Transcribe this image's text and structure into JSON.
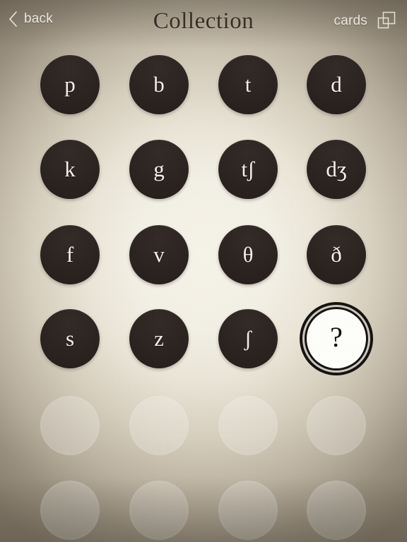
{
  "header": {
    "back_label": "back",
    "back_icon": "chevron-left-icon",
    "title": "Collection",
    "cards_label": "cards",
    "cards_icon": "overlapping-squares-icon"
  },
  "colors": {
    "background_center": "#f2efe4",
    "background_edge": "#857b6b",
    "tile_fill": "#2c2421",
    "tile_glyph": "#f4f0e8",
    "title_text": "#382e24",
    "header_text": "#ece8e1",
    "unknown_tile_fill": "#fdfdfa",
    "unknown_tile_ring": "#151210",
    "placeholder_tile": "rgba(255,255,255,0.22)"
  },
  "grid": {
    "columns": 4,
    "tiles": [
      {
        "label": "p",
        "state": "filled"
      },
      {
        "label": "b",
        "state": "filled"
      },
      {
        "label": "t",
        "state": "filled"
      },
      {
        "label": "d",
        "state": "filled"
      },
      {
        "label": "k",
        "state": "filled"
      },
      {
        "label": "g",
        "state": "filled"
      },
      {
        "label": "tʃ",
        "state": "filled"
      },
      {
        "label": "dʒ",
        "state": "filled"
      },
      {
        "label": "f",
        "state": "filled"
      },
      {
        "label": "v",
        "state": "filled"
      },
      {
        "label": "θ",
        "state": "filled"
      },
      {
        "label": "ð",
        "state": "filled"
      },
      {
        "label": "s",
        "state": "filled"
      },
      {
        "label": "z",
        "state": "filled"
      },
      {
        "label": "ʃ",
        "state": "filled"
      },
      {
        "label": "?",
        "state": "unknown"
      },
      {
        "label": "",
        "state": "empty"
      },
      {
        "label": "",
        "state": "empty"
      },
      {
        "label": "",
        "state": "empty"
      },
      {
        "label": "",
        "state": "empty"
      },
      {
        "label": "",
        "state": "empty"
      },
      {
        "label": "",
        "state": "empty"
      },
      {
        "label": "",
        "state": "empty"
      },
      {
        "label": "",
        "state": "empty"
      }
    ]
  }
}
